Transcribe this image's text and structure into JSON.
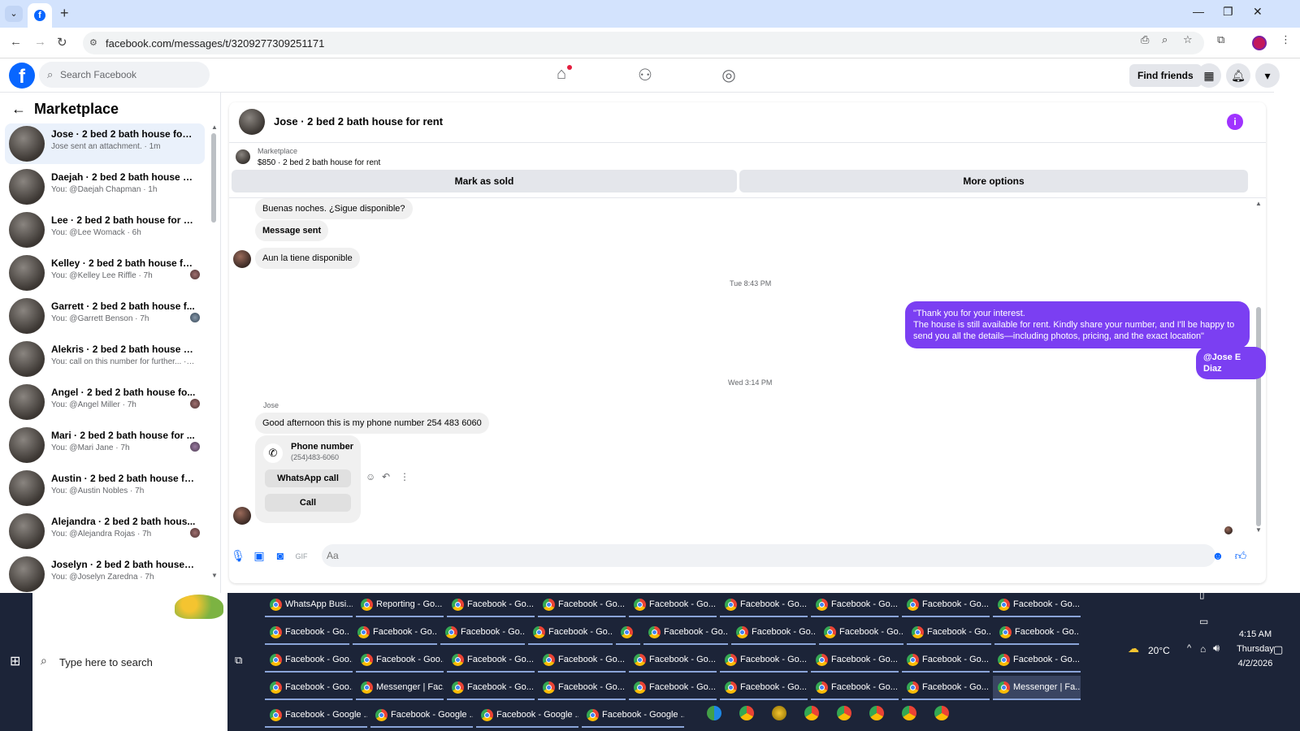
{
  "browser": {
    "url": "facebook.com/messages/t/3209277309251171",
    "tab_dropdown": "⌄",
    "new_tab": "+",
    "fb_favicon": "f",
    "min": "—",
    "restore": "❐",
    "close": "✕"
  },
  "fb": {
    "logo": "f",
    "search_placeholder": "Search Facebook",
    "find_friends": "Find friends"
  },
  "sidebar": {
    "title": "Marketplace",
    "conversations": [
      {
        "title": "Jose · 2 bed 2 bath house for rent",
        "sub": "Jose sent an attachment. · 1m",
        "active": true
      },
      {
        "title": "Daejah · 2 bed 2 bath house for ...",
        "sub": "You: @Daejah Chapman · 1h"
      },
      {
        "title": "Lee · 2 bed 2 bath house for rent",
        "sub": "You: @Lee Womack · 6h"
      },
      {
        "title": "Kelley · 2 bed 2 bath house fo...",
        "sub": "You: @Kelley Lee Riffle · 7h"
      },
      {
        "title": "Garrett · 2 bed 2 bath house f...",
        "sub": "You: @Garrett Benson · 7h"
      },
      {
        "title": "Alekris · 2 bed 2 bath house for ...",
        "sub": "You: call on this number for further... · 7h"
      },
      {
        "title": "Angel · 2 bed 2 bath house fo...",
        "sub": "You: @Angel Miller · 7h"
      },
      {
        "title": "Mari · 2 bed 2 bath house for ...",
        "sub": "You: @Mari Jane · 7h"
      },
      {
        "title": "Austin · 2 bed 2 bath house for ...",
        "sub": "You: @Austin Nobles · 7h"
      },
      {
        "title": "Alejandra · 2 bed 2 bath hous...",
        "sub": "You: @Alejandra Rojas · 7h"
      },
      {
        "title": "Joselyn · 2 bed 2 bath house for...",
        "sub": "You: @Joselyn Zaredna · 7h"
      }
    ]
  },
  "chat": {
    "header_title": "Jose · 2 bed 2 bath house for rent",
    "info_icon": "i",
    "marketplace_label": "Marketplace",
    "listing": "$850 · 2 bed 2 bath house for rent",
    "mark_sold": "Mark as sold",
    "more_options": "More options",
    "msg1": "Buenas noches. ¿Sigue disponible?",
    "msg2": "Message sent",
    "msg3": "Aun la tiene disponible",
    "ts1": "Tue 8:43 PM",
    "out_line1": "\"Thank you for your interest.",
    "out_line2": "The house is still available for rent. Kindly share your number, and I'll be happy to",
    "out_line3": "send you all the details—including photos, pricing, and the exact location\"",
    "mention": "@Jose E Diaz",
    "ts2": "Wed 3:14 PM",
    "sender": "Jose",
    "msg4": "Good afternoon  this is my phone number 254 483 6060",
    "card_label": "Phone number",
    "card_number": "(254)483-6060",
    "whatsapp_call": "WhatsApp call",
    "call": "Call",
    "composer_placeholder": "Aa"
  },
  "taskbar": {
    "search_text": "Type here to search",
    "rows": [
      [
        "WhatsApp Busi...",
        "Reporting - Go...",
        "Facebook - Go...",
        "Facebook - Go...",
        "Facebook - Go...",
        "Facebook - Go...",
        "Facebook - Go...",
        "Facebook - Go...",
        "Facebook - Go..."
      ],
      [
        "Facebook - Go...",
        "Facebook - Go...",
        "Facebook - Go...",
        "Facebook - Go...",
        "",
        "Facebook - Go...",
        "Facebook - Go...",
        "Facebook - Go...",
        "Facebook - Go...",
        "Facebook - Go..."
      ],
      [
        "Facebook - Goo...",
        "Facebook - Goo...",
        "Facebook - Go...",
        "Facebook - Go...",
        "Facebook - Go...",
        "Facebook - Go...",
        "Facebook - Go...",
        "Facebook - Go...",
        "Facebook - Go..."
      ],
      [
        "Facebook - Goo...",
        "Messenger | Fac...",
        "Facebook - Go...",
        "Facebook - Go...",
        "Facebook - Go...",
        "Facebook - Go...",
        "Facebook - Go...",
        "Facebook - Go...",
        "Messenger | Fa..."
      ],
      [
        "Facebook - Google ...",
        "Facebook - Google ...",
        "Facebook - Google ...",
        "Facebook - Google ..."
      ]
    ],
    "weather": "20°C",
    "time": "4:15 AM",
    "day": "Thursday",
    "date": "4/2/2026"
  }
}
